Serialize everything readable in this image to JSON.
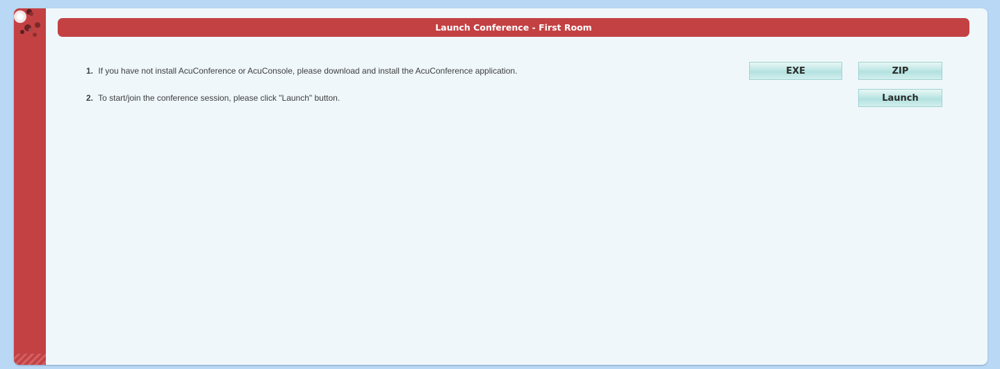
{
  "header": {
    "title": "Launch Conference - First Room"
  },
  "steps": [
    {
      "number": "1.",
      "text": "If you have not install AcuConference or AcuConsole, please download and install the AcuConference application."
    },
    {
      "number": "2.",
      "text": "To start/join the conference session, please click \"Launch\" button."
    }
  ],
  "buttons": {
    "exe_label": "EXE",
    "zip_label": "ZIP",
    "launch_label": "Launch"
  },
  "colors": {
    "accent_red": "#c34143",
    "panel_background": "#eff7fb",
    "page_background": "#b9d8f5",
    "button_teal": "#bfe7e5"
  }
}
